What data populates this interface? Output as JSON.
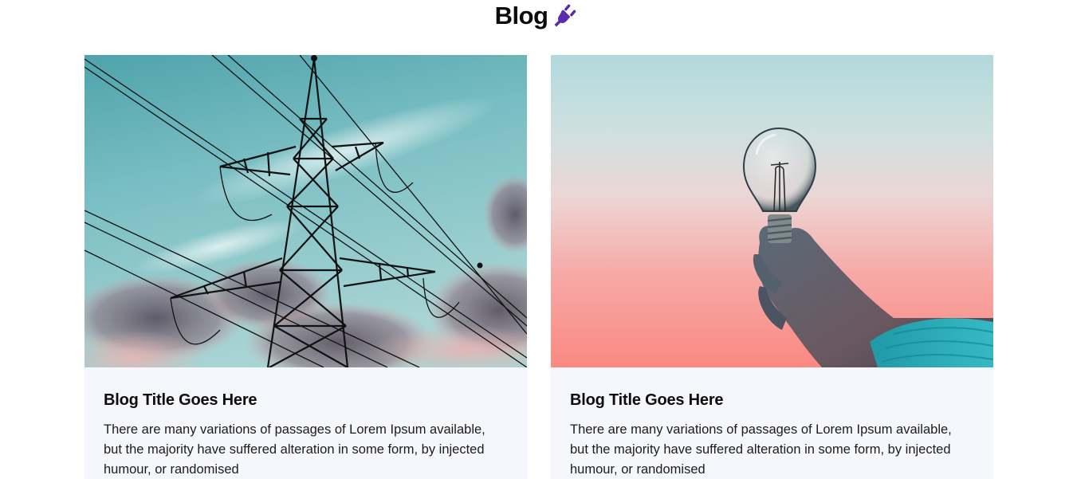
{
  "header": {
    "title": "Blog",
    "icon": "plug-icon",
    "icon_color": "#5b2aa8"
  },
  "posts": [
    {
      "image": "power-transmission-tower-photo",
      "title": "Blog Title Goes Here",
      "excerpt": "There are many variations of passages of Lorem Ipsum available, but the majority have suffered alteration in some form, by injected humour, or randomised"
    },
    {
      "image": "hand-holding-light-bulb-photo",
      "title": "Blog Title Goes Here",
      "excerpt": "There are many variations of passages of Lorem Ipsum available, but the majority have suffered alteration in some form, by injected humour, or randomised"
    }
  ],
  "colors": {
    "card_background": "#f6f7fc",
    "text": "#111111"
  }
}
